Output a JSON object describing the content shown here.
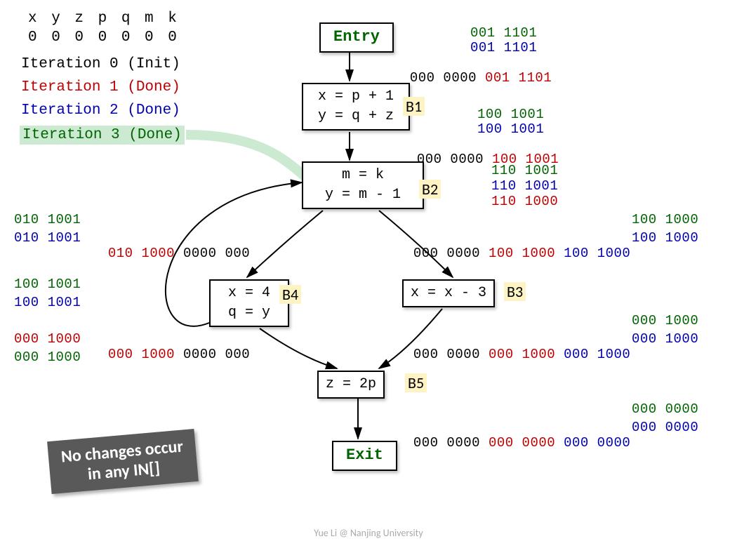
{
  "vars_header": "x y z p q m k",
  "vars_init": "0 0 0 0 0 0 0",
  "iter0": "Iteration 0 (Init)",
  "iter1": "Iteration 1 (Done)",
  "iter2": "Iteration 2 (Done)",
  "iter3": "Iteration 3 (Done)",
  "entry": "Entry",
  "exit": "Exit",
  "b1_line1": "x = p + 1",
  "b1_line2": "y = q + z",
  "b2_line1": "m = k",
  "b2_line2": "y = m - 1",
  "b3_line1": "x = x - 3",
  "b4_line1": "x = 4",
  "b4_line2": "q = y",
  "b5_line1": "z = 2p",
  "lbl_b1": "B1",
  "lbl_b2": "B2",
  "lbl_b3": "B3",
  "lbl_b4": "B4",
  "lbl_b5": "B5",
  "bits": {
    "entry_g": "001 1101",
    "entry_b": "001 1101",
    "entry_full": "000 0000 001 1101",
    "b1out_g": "100 1001",
    "b1out_b": "100 1001",
    "b1out_full": "000 0000 100 1001",
    "b2out_g": "110 1001",
    "b2out_b": "110 1001",
    "b2out_r": "110 1000",
    "b3in_full": "000 0000 100 1000 100 1000",
    "b3in_g": "100 1000",
    "b3in_b": "100 1000",
    "b4in_g": "010 1001",
    "b4in_b": "010 1001",
    "b4in_full": "010 1000 0000 000",
    "b4out_g": "100 1001",
    "b4out_b": "100 1001",
    "b4out_r1": "000 1000",
    "b4out_full": "000 1000 0000 000",
    "b4out_last": "000 1000",
    "b3out_full": "000 0000 000 1000 000 1000",
    "b3out_g": "000 1000",
    "b3out_b": "000 1000",
    "exit_full": "000 0000 000 0000 000 0000",
    "exit_g": "000 0000",
    "exit_b": "000 0000"
  },
  "callout": "No changes occur\nin any IN[]",
  "footer": "Yue Li @ Nanjing University"
}
